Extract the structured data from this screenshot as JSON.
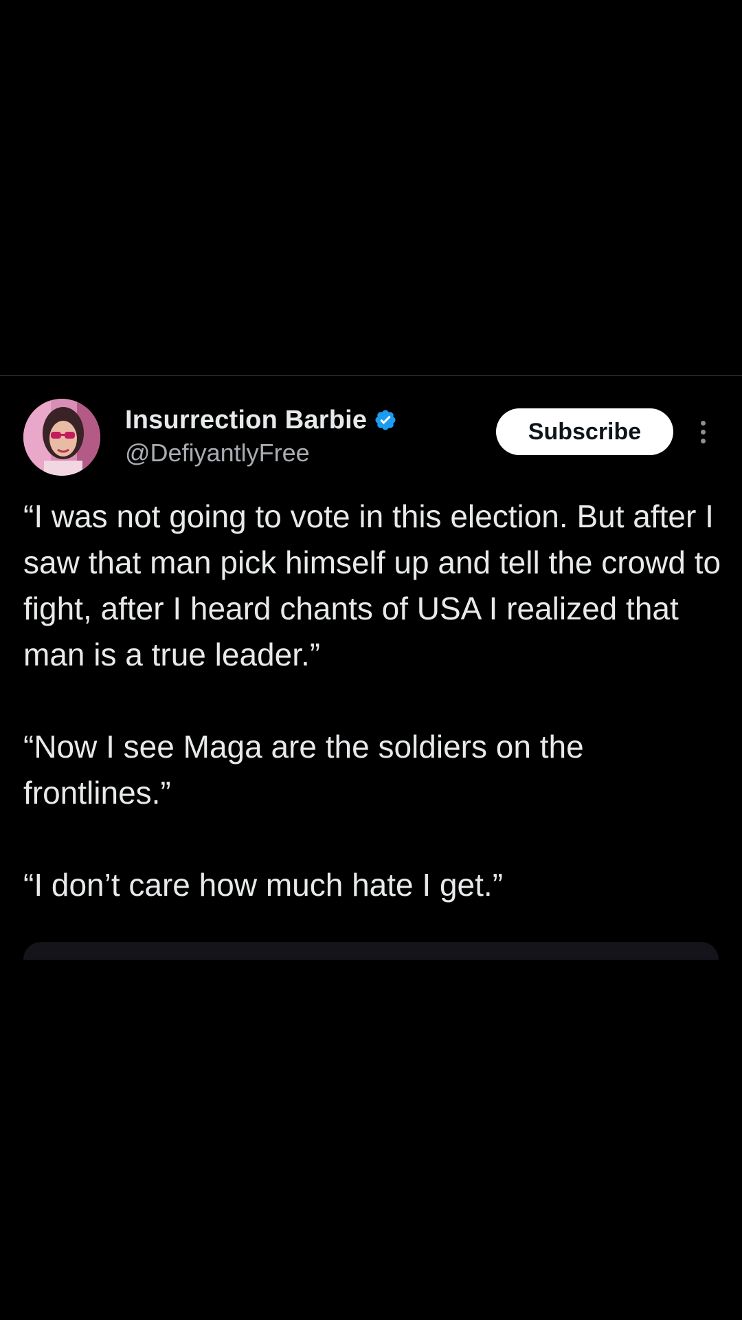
{
  "tweet": {
    "author": {
      "display_name": "Insurrection Barbie",
      "handle": "@DefiyantlyFree",
      "verified": true,
      "avatar_icon": "profile-photo"
    },
    "subscribe_label": "Subscribe",
    "more_icon": "more-vertical-icon",
    "paragraphs": [
      "“I was not going to vote in this election. But after I saw that man pick himself up and tell the crowd to fight, after I heard chants of USA I realized that man is a true leader.”",
      "“Now I see Maga are the soldiers on the frontlines.”",
      "“I don’t care how much hate I get.”"
    ]
  },
  "colors": {
    "background": "#000000",
    "text": "#e7e9ea",
    "secondary_text": "#a8adb2",
    "verified_badge": "#1d9bf0",
    "button_bg": "#ffffff",
    "button_text": "#0f1419"
  }
}
